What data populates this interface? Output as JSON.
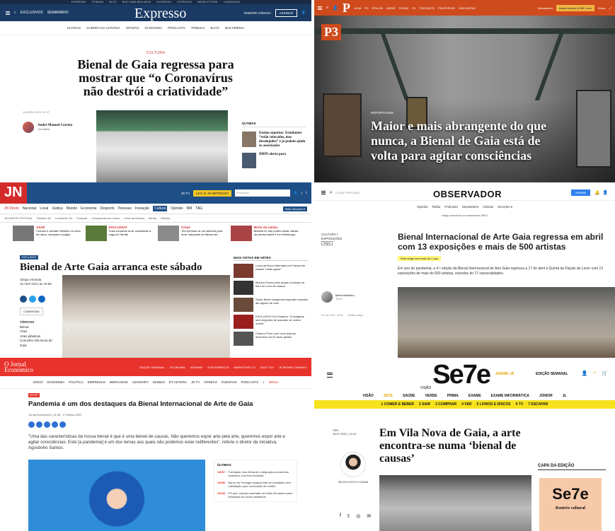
{
  "expresso": {
    "top_links": [
      "EXPRESSO",
      "TRIBUNA",
      "BLITZ",
      "BOA CAMA BOA MESA",
      "EXPRESSO",
      "EXPRESSO",
      "NEWSLETTERS",
      "CAMPANHAS"
    ],
    "left_links": [
      "EXCLUSIVOS",
      "SEMANÁRIO"
    ],
    "logo": "Expresso",
    "code_link": "INSERIR CÓDIGO",
    "subscribe": "ASSINAR",
    "nav": [
      "ÚLTIMAS",
      "GUERRA NA UCRÂNIA",
      "OPINIÃO",
      "ECONOMIA",
      "PODCASTS",
      "TRIBUNA",
      "BLITZ",
      "MULTIMÉDIA"
    ],
    "category": "CULTURA",
    "title": "Bienal de Gaia regressa para mostrar que “o Coronavírus não destrói a criatividade”",
    "date": "15 ABRIL 2021 19:37",
    "author_name": "André Manuel Correia",
    "author_role": "Jornalista",
    "sidebar_heading": "ÚLTIMAS",
    "sidebar_item_1": "Ensino superior: Estudantes “estão colocados, mas desalojados” e já podem ajuda às associações",
    "sidebar_item_2": "DHIN alerta para"
  },
  "p3": {
    "logo": "P",
    "nav": [
      "AGIA",
      "P3",
      "ÍPSILON",
      "IMPAR",
      "FUGAS",
      "P3",
      "PODCASTS",
      "PSUPERIOR",
      "ONDCASTAZ"
    ],
    "newsletters": "Newsletters",
    "cta": "Assine desde 4,99€ / mês",
    "login": "Entrar",
    "badge": "P3",
    "category": "REPORTAGEM",
    "title": "Maior e mais abrangente do que nunca, a Bienal de Gaia está de volta para agitar consciências"
  },
  "jn": {
    "logo": "JN",
    "tv": "JN TV",
    "print": "LEIA O JN IMPRESSO",
    "search_placeholder": "Pesquisar",
    "nav": [
      "JN Direto",
      "Nacional",
      "Local",
      "Justiça",
      "Mundo",
      "Economia",
      "Desporto",
      "Pessoas",
      "Inovação",
      "Cultura",
      "Opinião",
      "NM",
      "TAG"
    ],
    "active_nav": "Cultura",
    "more_sections": "Mais Secções ▾",
    "subnav": [
      "JN NORTH FESTIVAL",
      "Festival JN",
      "Concertos JN",
      "Comprar",
      "Companhia dos Livros",
      "Casa da Música",
      "Media",
      "História"
    ],
    "strip": [
      {
        "kicker": "ASAE",
        "text": "Cravam e aceitam bilhetes no meio de ratos, carraças e pulgas"
      },
      {
        "kicker": "EXCLUSIVO",
        "text": "Toda comanda lá de candidatos à vaga de Tarrafe"
      },
      {
        "kicker": "Crime",
        "text": "Tira prensas de um sistema para levar máquinas de tabaco de..."
      },
      {
        "kicker": "Morte da rainha",
        "text": "Britânia no são podes visitar caixão da rainha Isabel II em Edimburgo"
      }
    ],
    "exclusive_tag": "EXCLUSIVO",
    "title": "Bienal de Arte Gaia arranca este sábado",
    "byline_name": "Sérgio Almeida",
    "byline_date": "16 Abril 2021 às 23:56",
    "comment": "COMENTAR",
    "tags_heading": "TÓPICOS",
    "tags": [
      "Bienal",
      "Artes",
      "Artes plásticas",
      "Concelho Vila Nova de Gaia"
    ],
    "sidebar_heading": "MAIS VISTAS EM ARTES",
    "sidebar": [
      "Lúcia da Nova internada em França em estado “muito grave”",
      "Mónica Flores sobe angue conheça na feira do Livro de Lisboa",
      "Santo Beber sangrento ilegenato monalal até agosto de vida",
      "EXCLUSIVO Em Estados: “A sinigaras sem tergunha de assustá- se contra ordem”",
      "Colbum Porto com nova data ao dezenhos há 20 anos ajeitos"
    ]
  },
  "observador": {
    "search_placeholder": "O QUE PROCURA",
    "logo": "OBSERVADOR",
    "subscribe": "Assinar",
    "nav": [
      "Opinião",
      "Rádio",
      "Podcasts",
      "Newsletters",
      "Últimas",
      "Secções ▾"
    ],
    "meo": "artigo acessível por assinatura MEO",
    "category": "CULTURA / EXPOSIÇÕES",
    "follow": "Seguir",
    "title": "Bienal Internacional de Arte Gaia regressa em abril com 13 exposições e mais de 500 artistas",
    "listen": "Este artigo tem mais de 1 ano",
    "lead": "Em ano de pandemia, a 4.ª edição da Bienal Internacional de Arte Gaia regressa a 17 de abril à Quinta da Fiação de Lever com 13 exposições de mais de 500 artistas, oriundos de 17 nacionalidades.",
    "author_name": "Maria Martinho",
    "author_role": "Texto",
    "date": "04 mar 2021, 19:34",
    "share": "Partilhe artigo"
  },
  "je": {
    "logo_line1": "O Jornal",
    "logo_line2": "Económico",
    "nav1": [
      "EDIÇÃO SEMANAL",
      "ECONOMIA",
      "ASSINAR",
      "SUPLEMENTOS",
      "MARKETING 2.0",
      "EASY TAX",
      "JE BRAND CHANNEL"
    ],
    "nav2": [
      "INÍCIO",
      "ECONOMIA",
      "POLÍTICA",
      "EMPRESAS",
      "MERCADOS",
      "ADVISORY",
      "MUNDO",
      "ET CETERA",
      "JE TV",
      "OPINIÃO",
      "EVENTOS",
      "PODCASTS"
    ],
    "menu": "MENU",
    "tag": "ARTES",
    "title": "Pandemia é um dos destaques da Bienal Internacional de Arte de Gaia",
    "byline": "Jornal Económico | 14:38 · 17 Março 2021",
    "lead": "\"Uma das características da nossa bienal é que é uma bienal de causas. Não queremos expor arte pela arte, queremos expor arte e agitar consciências. Este [a pandemia] é um dos temas aos quais não podemos estar indiferentes\", referiu o diretor da iniciativa, Agostinho Santos.",
    "sidebar_heading": "ÚLTIMAS",
    "sidebar": [
      {
        "time": "18h57",
        "text": "Fundação José Berardo: Integração providencia cauteleus com tina exclusão"
      },
      {
        "time": "18h56",
        "text": "Banco de Portugal atualiza lista de entidades sem habilitação para concessão de crédito"
      },
      {
        "time": "18h54",
        "text": "PS quer solução acertada na União Europeia sobre tributação de lucros aleatórios"
      }
    ]
  },
  "visao": {
    "logo_prefix": "VISÃO",
    "logo": "Se7e",
    "subscribe": "ASSINE JÁ",
    "weekly": "EDIÇÃO SEMANAL",
    "nav": [
      "VISÃO",
      "SETE",
      "SAÚDE",
      "VERDE",
      "PRIMA",
      "EXAME",
      "EXAME INFORMÁTICA",
      "JÚNIOR",
      "JL"
    ],
    "active_nav": "SETE",
    "sections": [
      "1 COMER E BEBER",
      "2 SAIR",
      "3 COMPRAR",
      "4 VER",
      "5 LIVROS E DISCOS",
      "6 TV",
      "7 ESCAPAR"
    ],
    "category": "VER",
    "date": "16.07.2021 | 14:13",
    "title": "Em Vila Nova de Gaia, a arte encontra-se numa ‘bienal de causas’",
    "author": "SÍLVIA SOUTO CUNHA",
    "cover_heading": "CAPA DA EDIÇÃO",
    "cover_logo": "Se7e",
    "cover_text": "Rentrée cultural"
  }
}
